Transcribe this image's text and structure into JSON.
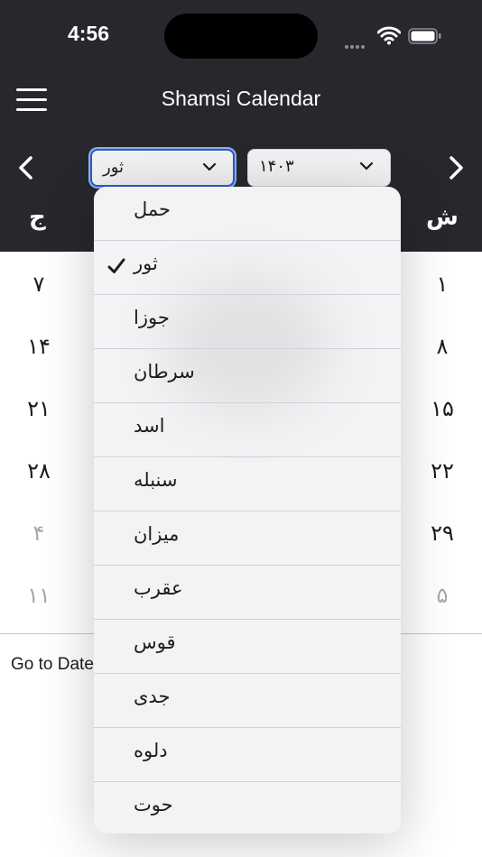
{
  "status_bar": {
    "time": "4:56"
  },
  "nav": {
    "title": "Shamsi Calendar"
  },
  "selectors": {
    "month_value": "ثور",
    "year_value": "۱۴۰۳"
  },
  "weekday_headers": {
    "first": "ش",
    "last": "ج"
  },
  "days": {
    "right_column": [
      "۱",
      "۸",
      "۱۵",
      "۲۲",
      "۲۹",
      "۵"
    ],
    "left_column": [
      "۷",
      "۱۴",
      "۲۱",
      "۲۸",
      "۴",
      "۱۱"
    ]
  },
  "goto_label": "Go to Date",
  "month_dropdown": {
    "options": [
      "حمل",
      "ثور",
      "جوزا",
      "سرطان",
      "اسد",
      "سنبله",
      "میزان",
      "عقرب",
      "قوس",
      "جدی",
      "دلوه",
      "حوت"
    ],
    "selected": "ثور"
  }
}
